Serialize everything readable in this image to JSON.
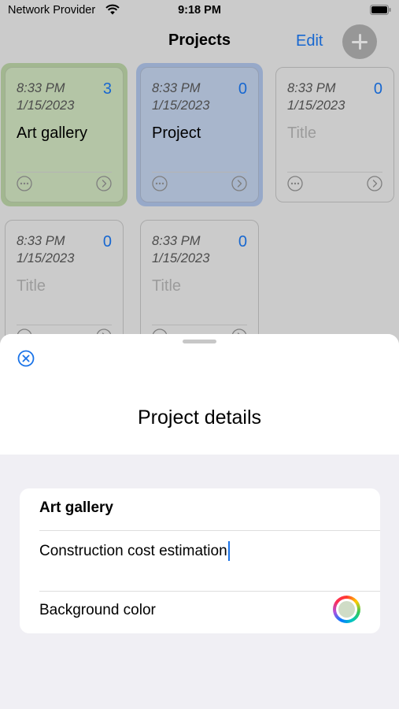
{
  "status_bar": {
    "carrier": "Network Provider",
    "time": "9:18 PM"
  },
  "nav": {
    "title": "Projects",
    "edit_label": "Edit",
    "add_icon": "plus-icon"
  },
  "projects": [
    {
      "time": "8:33 PM",
      "date": "1/15/2023",
      "count": "3",
      "title": "Art gallery",
      "placeholder": "Title",
      "color": "#c9dcb9",
      "highlight": "#b5cca1"
    },
    {
      "time": "8:33 PM",
      "date": "1/15/2023",
      "count": "0",
      "title": "Project",
      "placeholder": "Title",
      "color": "#bccbe4",
      "highlight": "#a9bde0"
    },
    {
      "time": "8:33 PM",
      "date": "1/15/2023",
      "count": "0",
      "title": "",
      "placeholder": "Title",
      "color": "#e3e3e3",
      "highlight": ""
    },
    {
      "time": "8:33 PM",
      "date": "1/15/2023",
      "count": "0",
      "title": "",
      "placeholder": "Title",
      "color": "#e3e3e3",
      "highlight": ""
    },
    {
      "time": "8:33 PM",
      "date": "1/15/2023",
      "count": "0",
      "title": "",
      "placeholder": "Title",
      "color": "#e3e3e3",
      "highlight": ""
    }
  ],
  "sheet": {
    "title": "Project details",
    "close_icon": "close-circle-icon",
    "name_value": "Art gallery",
    "description_value": "Construction cost estimation",
    "background_color_label": "Background color",
    "background_color_value": "#cfdcc6"
  },
  "colors": {
    "accent": "#1a73e8"
  }
}
